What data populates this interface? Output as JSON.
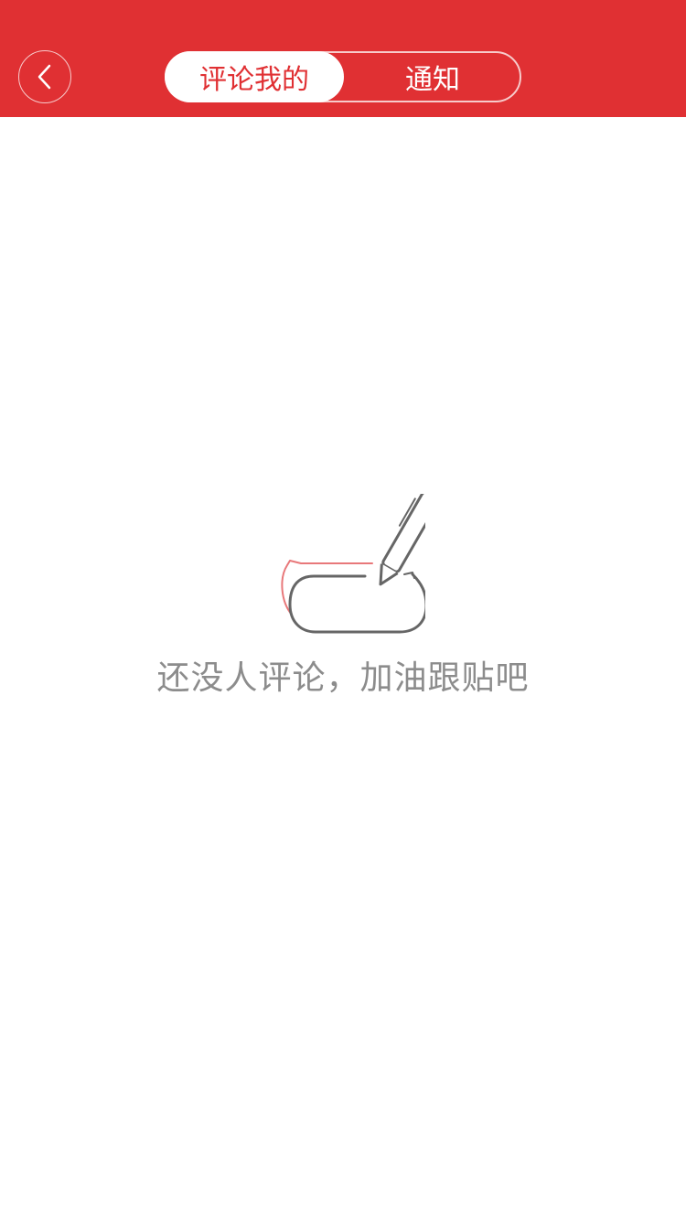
{
  "header": {
    "back_icon": "chevron-left-icon",
    "tabs": [
      {
        "label": "评论我的",
        "active": true
      },
      {
        "label": "通知",
        "active": false
      }
    ]
  },
  "empty_state": {
    "illustration_icon": "pen-writing-icon",
    "message": "还没人评论，加油跟贴吧"
  },
  "colors": {
    "brand": "#e03033",
    "text_muted": "#8c8c8c",
    "illustration_stroke": "#666666",
    "illustration_accent": "#e8787a"
  }
}
